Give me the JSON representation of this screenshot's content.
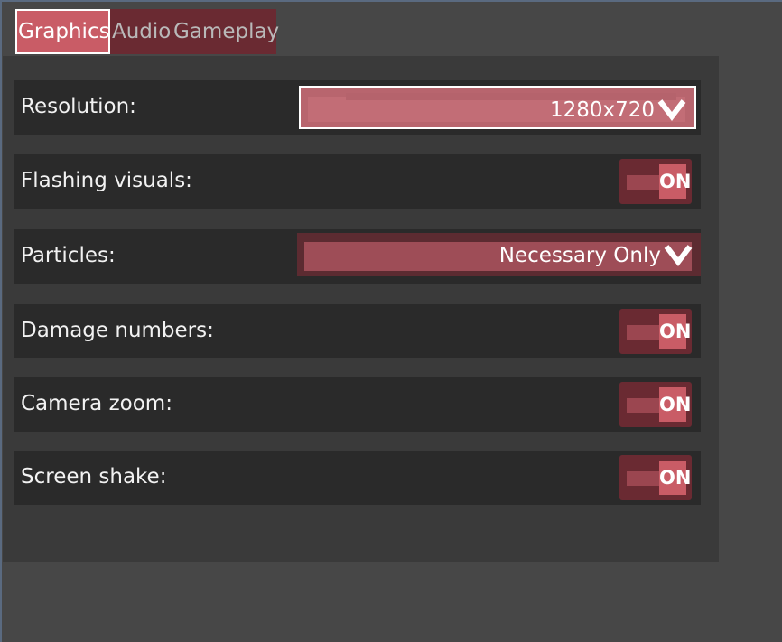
{
  "tabs": [
    {
      "label": "Graphics",
      "active": true
    },
    {
      "label": "Audio",
      "active": false
    },
    {
      "label": "Gameplay",
      "active": false
    }
  ],
  "settings": {
    "resolution": {
      "label": "Resolution:",
      "value": "1280x720",
      "focused": true
    },
    "flashing": {
      "label": "Flashing visuals:",
      "state": "ON"
    },
    "particles": {
      "label": "Particles:",
      "value": "Necessary Only"
    },
    "damage": {
      "label": "Damage numbers:",
      "state": "ON"
    },
    "camera": {
      "label": "Camera zoom:",
      "state": "ON"
    },
    "shake": {
      "label": "Screen shake:",
      "state": "ON"
    }
  },
  "colors": {
    "accent": "#c95c66",
    "accent_dark": "#6a2a32",
    "row_bg": "#2a2a2a",
    "panel_bg": "#3a3a3a"
  }
}
